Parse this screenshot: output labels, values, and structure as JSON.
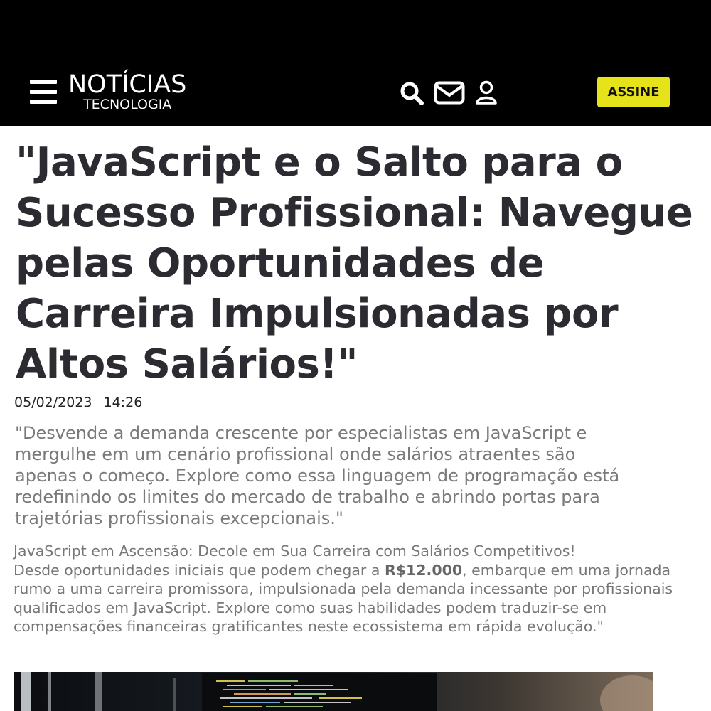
{
  "header": {
    "logo_main": "NOTÍCIAS",
    "logo_sub": "TECNOLOGIA",
    "subscribe_label": "ASSINE",
    "icons": [
      "menu-icon",
      "search-icon",
      "mail-icon",
      "user-icon"
    ]
  },
  "article": {
    "title": "\"JavaScript e o Salto para o Sucesso Profissional: Navegue pelas Oportunidades de Carreira Impulsionadas por Altos Salários!\"",
    "date": "05/02/2023",
    "time": "14:26",
    "lead": "\"Desvende a demanda crescente por especialistas em JavaScript e mergulhe em um cenário profissional onde salários atraentes são apenas o começo. Explore como essa linguagem de programação está redefinindo os limites do mercado de trabalho e abrindo portas para trajetórias profissionais excepcionais.\"",
    "body_line1": "JavaScript em Ascensão: Decole em Sua Carreira com Salários Competitivos!",
    "body_before_salary": "Desde oportunidades iniciais que podem chegar a ",
    "salary": "R$12.000",
    "body_after_salary": ", embarque em uma jornada rumo a uma carreira promissora,  impulsionada pela demanda incessante por profissionais qualificados em JavaScript. Explore como suas habilidades podem traduzir-se em  compensações financeiras gratificantes neste ecossistema em rápida evolução.\""
  },
  "colors": {
    "header_bg": "#000000",
    "accent": "#e7e31b",
    "title_text": "#2b2b31",
    "lead_text": "#7a7a7a"
  }
}
